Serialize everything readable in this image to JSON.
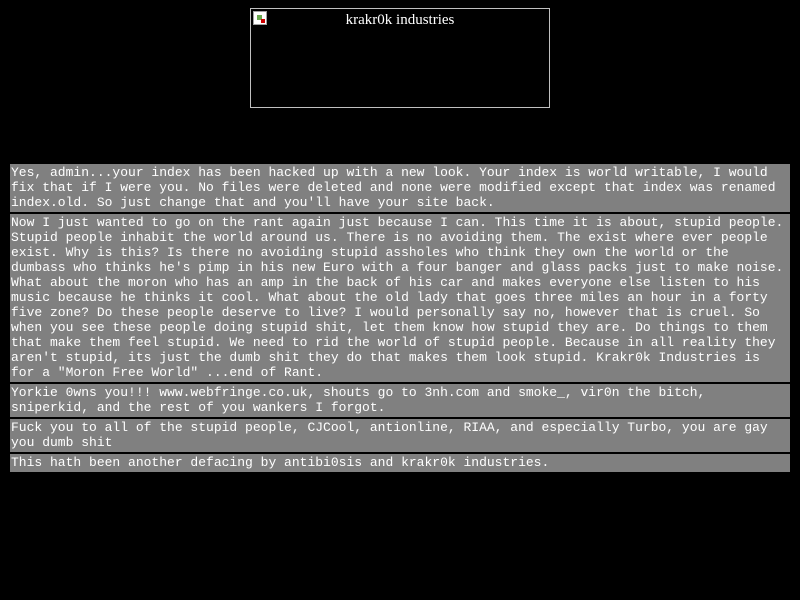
{
  "banner": {
    "alt_text": "krakr0k industries",
    "border_color": "#c0c0c0"
  },
  "colors": {
    "page_background": "#000000",
    "block_background": "#808080",
    "text": "#ffffff"
  },
  "messages": [
    "Yes, admin...your index has been hacked up with a new look. Your index is world writable, I would fix that if I were you. No files were deleted and none were modified except that index was renamed index.old. So just change that and you'll have your site back.",
    "Now I just wanted to go on the rant again just because I can. This time it is about, stupid people. Stupid people inhabit the world around us. There is no avoiding them. The exist where ever people exist. Why is this? Is there no avoiding stupid assholes who think they own the world or the dumbass who thinks he's pimp in his new Euro with a four banger and glass packs just to make noise. What about the moron who has an amp in the back of his car and makes everyone else listen to his music because he thinks it cool. What about the old lady that goes three miles an hour in a forty five zone? Do these people deserve to live? I would personally say no, however that is cruel. So when you see these people doing stupid shit, let them know how stupid they are. Do things to them that make them feel stupid. We need to rid the world of stupid people. Because in all reality they aren't stupid, its just the dumb shit they do that makes them look stupid. Krakr0k Industries is for a \"Moron Free World\" ...end of Rant.",
    "Yorkie 0wns you!!! www.webfringe.co.uk, shouts go to 3nh.com and smoke_, vir0n the bitch, sniperkid, and the rest of you wankers I forgot.",
    "Fuck you to all of the stupid people, CJCool, antionline, RIAA, and especially Turbo, you are gay you dumb shit",
    "This hath been another defacing by antibi0sis and krakr0k industries."
  ]
}
